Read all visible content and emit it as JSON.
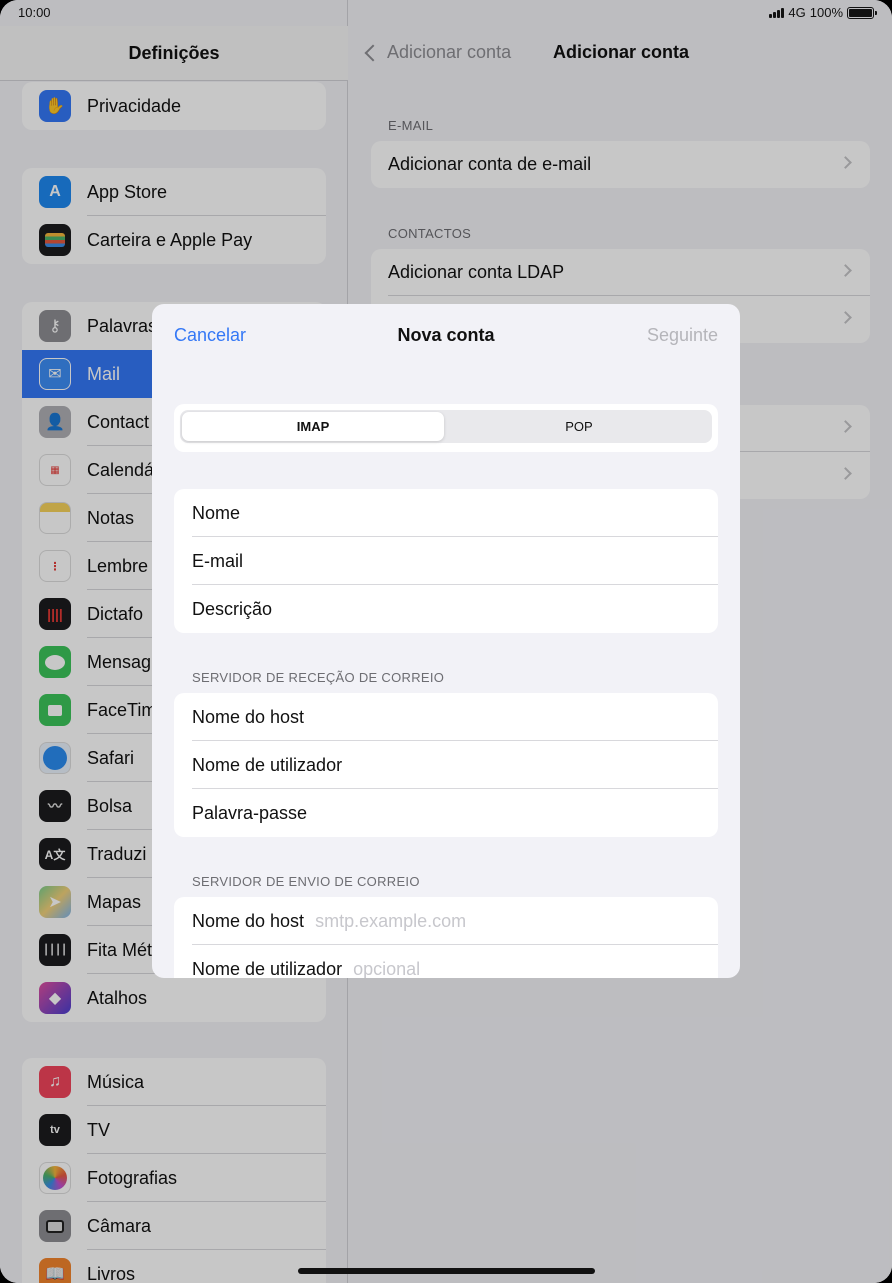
{
  "status_bar": {
    "time": "10:00",
    "network": "4G",
    "battery": "100%"
  },
  "sidebar": {
    "title": "Definições",
    "groups": [
      {
        "items": [
          {
            "label": "Privacidade",
            "icon": "hand-icon",
            "color": "#3478f6"
          }
        ]
      },
      {
        "items": [
          {
            "label": "App Store",
            "icon": "app-store-icon",
            "color": "#1e88f0"
          },
          {
            "label": "Carteira e Apple Pay",
            "icon": "wallet-icon",
            "color": "#1c1c1e"
          }
        ]
      },
      {
        "items": [
          {
            "label": "Palavras",
            "icon": "key-icon",
            "color": "#8e8e93"
          },
          {
            "label": "Mail",
            "icon": "mail-icon",
            "color": "#3d8ef5",
            "selected": true
          },
          {
            "label": "Contact",
            "icon": "contacts-icon",
            "color": "#a9a9ae"
          },
          {
            "label": "Calendá",
            "icon": "calendar-icon",
            "color": "#ffffff"
          },
          {
            "label": "Notas",
            "icon": "notes-icon",
            "color": "#f7d25b"
          },
          {
            "label": "Lembre",
            "icon": "reminders-icon",
            "color": "#ffffff"
          },
          {
            "label": "Dictafo",
            "icon": "voice-memos-icon",
            "color": "#1c1c1e"
          },
          {
            "label": "Mensag",
            "icon": "messages-icon",
            "color": "#3cc45a"
          },
          {
            "label": "FaceTim",
            "icon": "facetime-icon",
            "color": "#3cc45a"
          },
          {
            "label": "Safari",
            "icon": "safari-icon",
            "color": "#e9f2fd"
          },
          {
            "label": "Bolsa",
            "icon": "stocks-icon",
            "color": "#1c1c1e"
          },
          {
            "label": "Traduzi",
            "icon": "translate-icon",
            "color": "#1c1c1e"
          },
          {
            "label": "Mapas",
            "icon": "maps-icon",
            "color": "#7ccf8e"
          },
          {
            "label": "Fita Mét",
            "icon": "measure-icon",
            "color": "#1c1c1e"
          },
          {
            "label": "Atalhos",
            "icon": "shortcuts-icon",
            "color": "#4b3fd1"
          }
        ]
      },
      {
        "items": [
          {
            "label": "Música",
            "icon": "music-icon",
            "color": "#f1455b"
          },
          {
            "label": "TV",
            "icon": "tv-icon",
            "color": "#1c1c1e"
          },
          {
            "label": "Fotografias",
            "icon": "photos-icon",
            "color": "#ffffff"
          },
          {
            "label": "Câmara",
            "icon": "camera-icon",
            "color": "#8e8e93"
          },
          {
            "label": "Livros",
            "icon": "books-icon",
            "color": "#f2852c"
          }
        ]
      }
    ]
  },
  "detail": {
    "back_label": "Adicionar conta",
    "title": "Adicionar conta",
    "email_section": "E-MAIL",
    "email_item": "Adicionar conta de e-mail",
    "contacts_section": "CONTACTOS",
    "contacts_item": "Adicionar conta LDAP"
  },
  "modal": {
    "cancel": "Cancelar",
    "title": "Nova conta",
    "next": "Seguinte",
    "segments": [
      "IMAP",
      "POP"
    ],
    "account_fields": [
      "Nome",
      "E-mail",
      "Descrição"
    ],
    "incoming_section": "SERVIDOR DE RECEÇÃO DE CORREIO",
    "incoming_fields": [
      "Nome do host",
      "Nome de utilizador",
      "Palavra-passe"
    ],
    "outgoing_section": "SERVIDOR DE ENVIO DE CORREIO",
    "outgoing_fields": [
      {
        "label": "Nome do host",
        "placeholder": "smtp.example.com"
      },
      {
        "label": "Nome de utilizador",
        "placeholder": "opcional"
      }
    ]
  },
  "colors": {
    "accent": "#3478f6",
    "disabled": "#b5b5ba"
  }
}
